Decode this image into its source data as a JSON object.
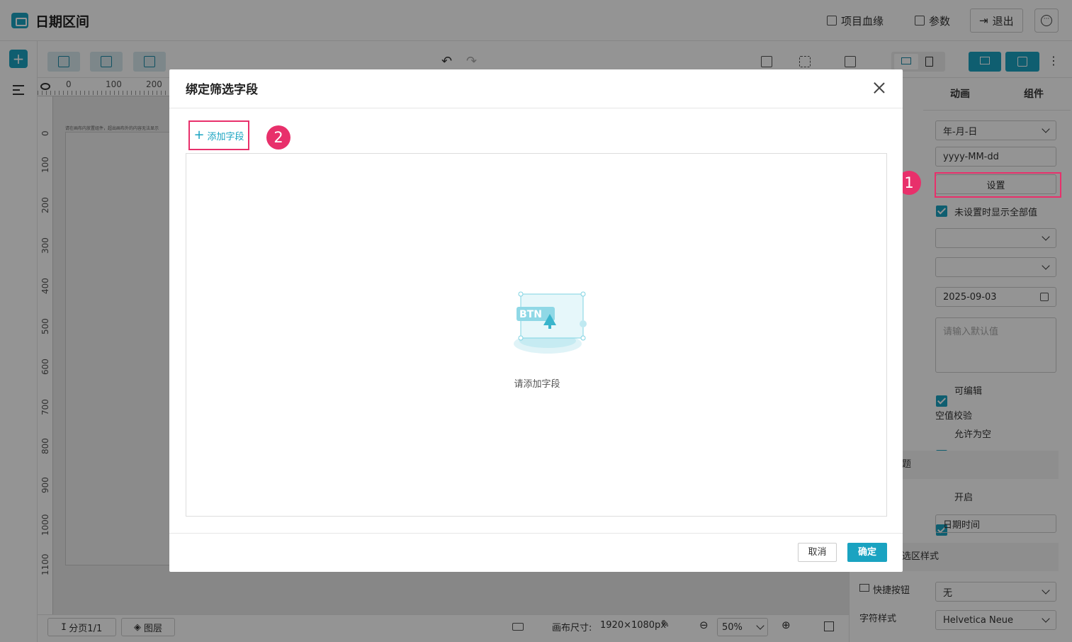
{
  "app": {
    "title": "日期区间"
  },
  "header": {
    "lineage_label": "项目血缘",
    "params_label": "参数",
    "exit_label": "退出"
  },
  "ruler": {
    "top_ticks": [
      "0",
      "100",
      "200"
    ],
    "left_ticks": [
      "0",
      "100",
      "200",
      "300",
      "400",
      "500",
      "600",
      "700",
      "800",
      "900",
      "1000",
      "1100"
    ]
  },
  "canvas": {
    "hint": "请在画布内放置组件，超出画布外的内容无法显示"
  },
  "bottom_bar": {
    "pages_label": "分页1/1",
    "layers_label": "图层",
    "canvas_size_label": "画布尺寸:",
    "canvas_size_value": "1920×1080px",
    "zoom_value": "50%"
  },
  "right_panel": {
    "tabs": [
      "动画",
      "组件"
    ],
    "date_format_select": "年-月-日",
    "date_format_pattern": "yyyy-MM-dd",
    "settings_button": "设置",
    "show_all_when_unset": "未设置时显示全部值",
    "date_value": "2025-09-03",
    "default_placeholder": "请输入默认值",
    "editable_label": "可编辑",
    "null_check_label": "空值校验",
    "allow_empty_label": "允许为空",
    "title_section_label": "题",
    "enable_label": "开启",
    "title_value": "日期时间",
    "filter_style_section": "选区样式",
    "quick_button_label": "快捷按钮",
    "quick_button_value": "无",
    "font_style_label": "字符样式",
    "font_style_value": "Helvetica Neue"
  },
  "modal": {
    "title": "绑定筛选字段",
    "add_field_label": "添加字段",
    "empty_text": "请添加字段",
    "illustration_text": "BTN",
    "cancel_label": "取消",
    "ok_label": "确定"
  },
  "annotations": {
    "step1": "1",
    "step2": "2"
  },
  "colors": {
    "accent": "#1aa3c1",
    "highlight": "#e8306b"
  }
}
